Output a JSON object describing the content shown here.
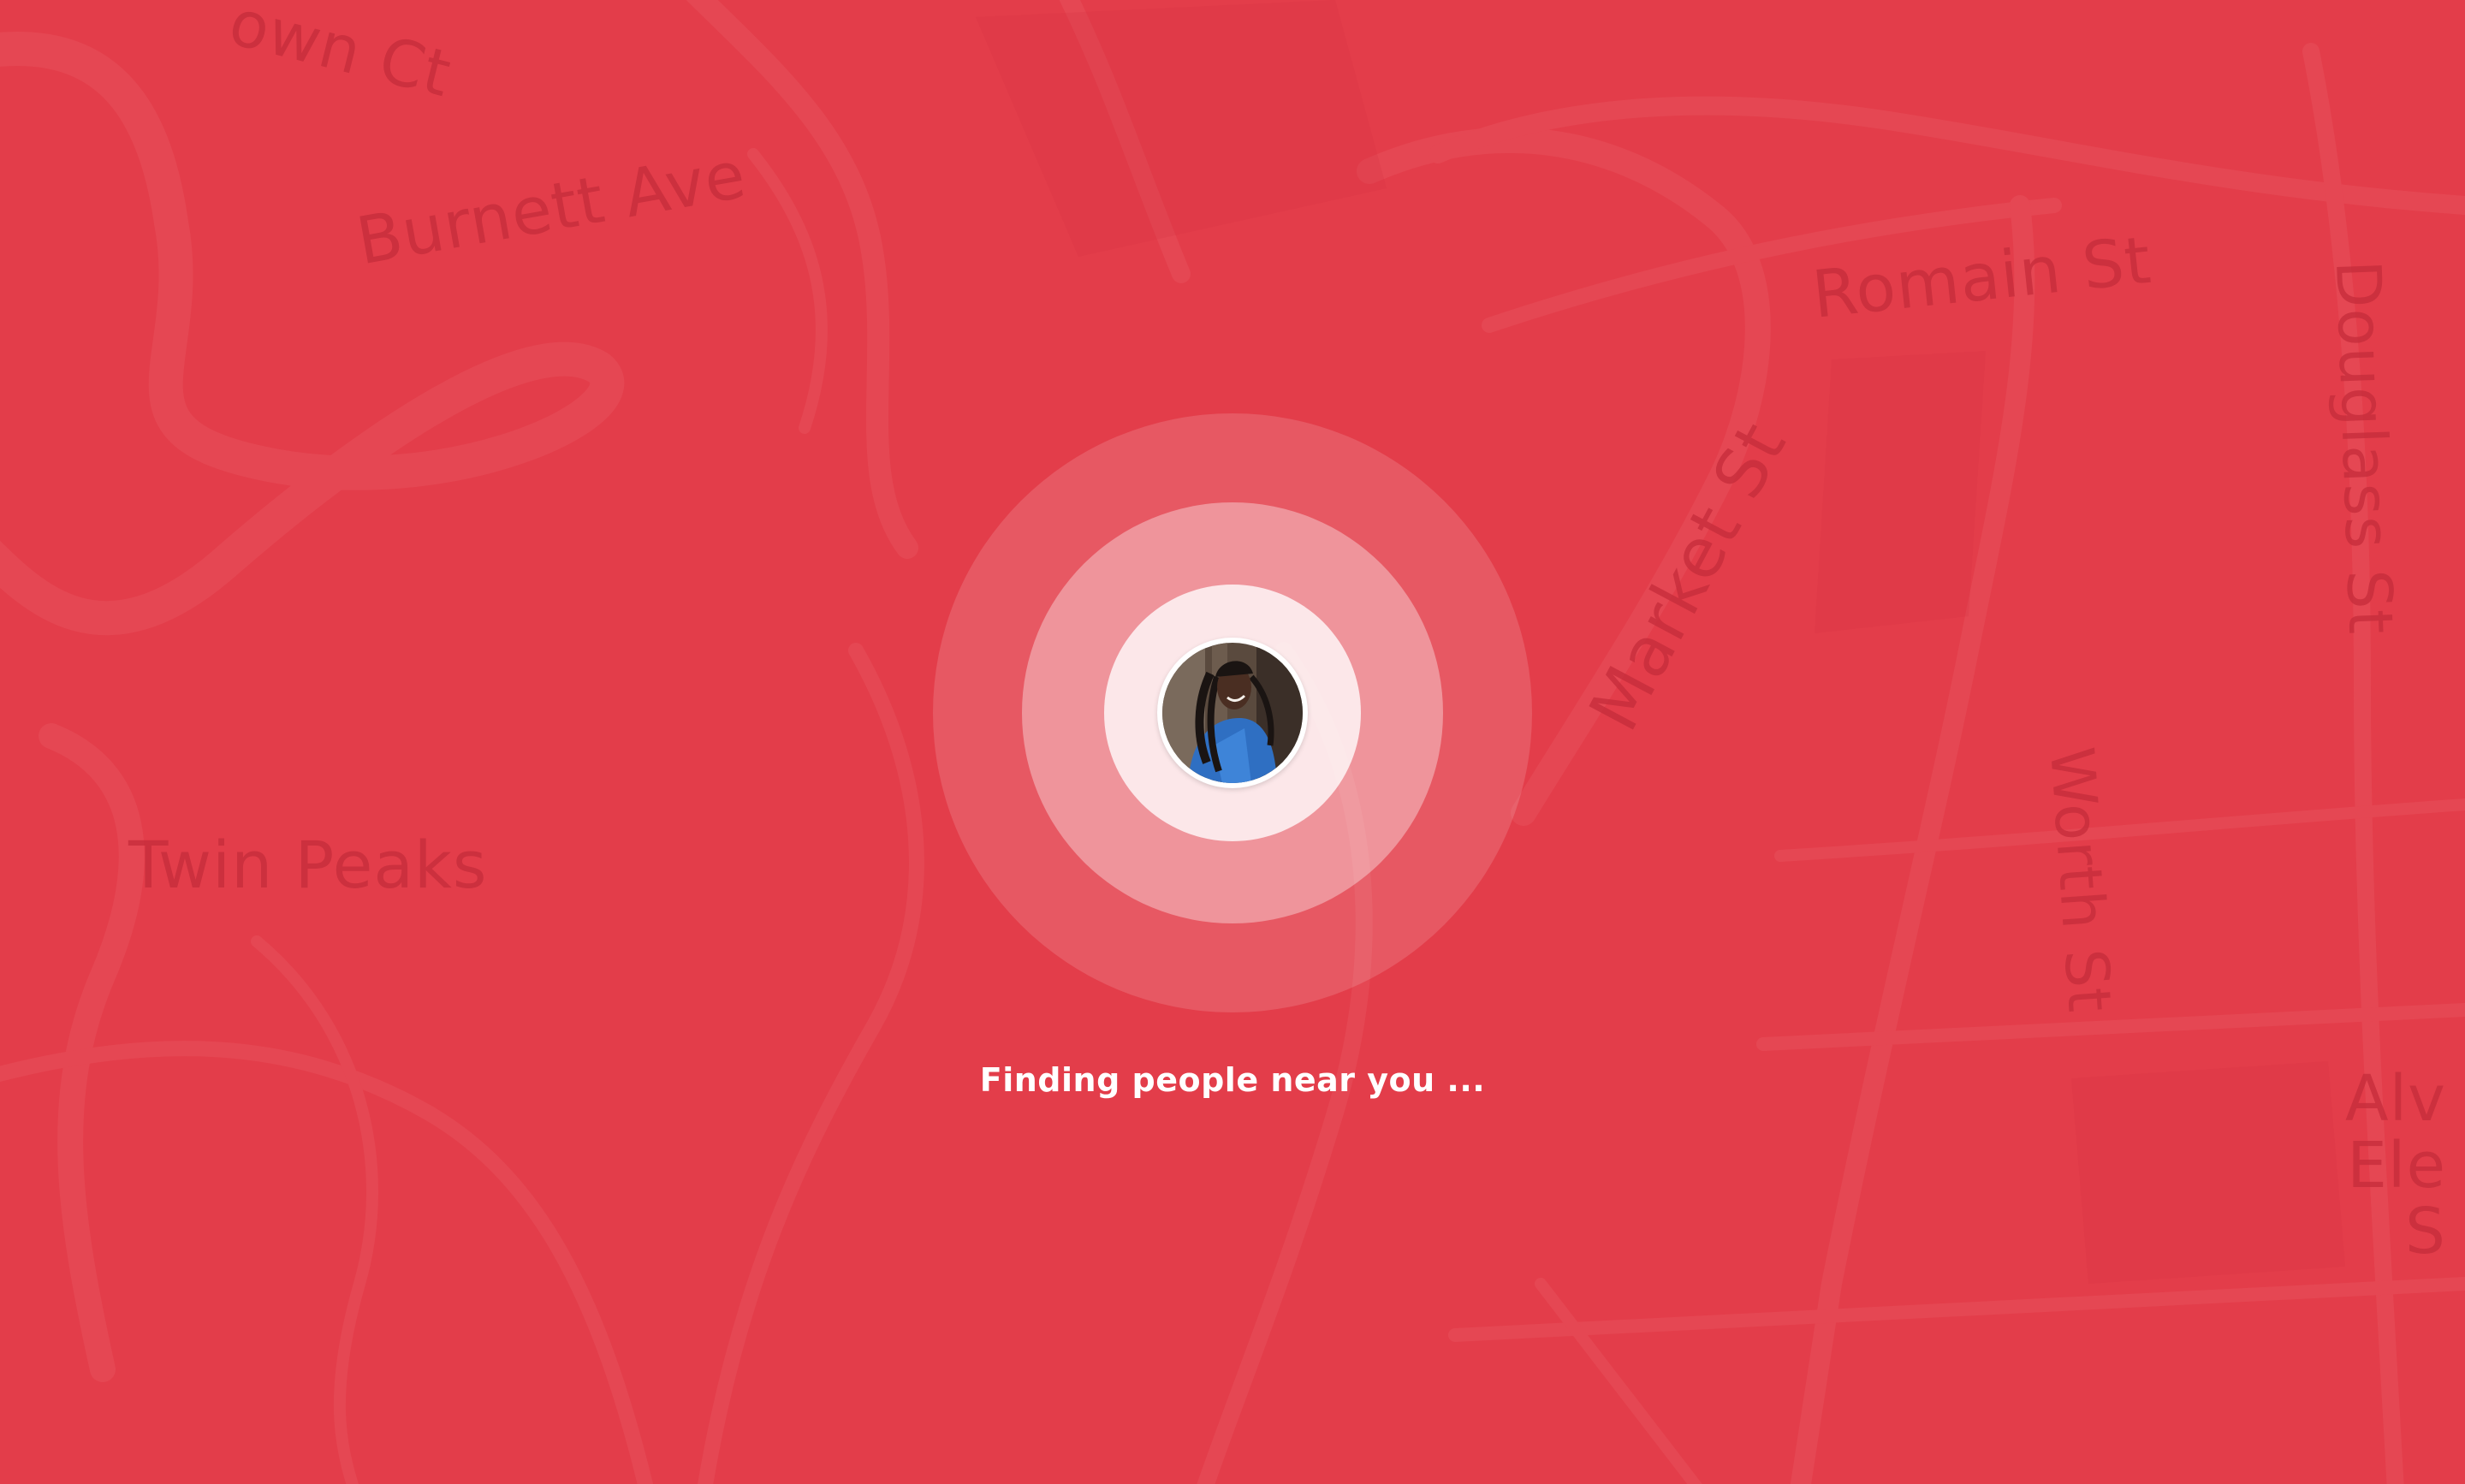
{
  "app": {
    "background_color": "#e33d4a",
    "accent_color": "#ffffff"
  },
  "map": {
    "street_labels": {
      "partial_court": "own Ct",
      "burnett": "Burnett Ave",
      "romain": "Romain St",
      "market": "Market St",
      "douglass": "Douglass St",
      "worth": "Worth St",
      "twin_peaks": "Twin Peaks",
      "alvarado": "Alv\nEle\nS"
    }
  },
  "search": {
    "status_text": "Finding people near you ...",
    "avatar_icon": "user-avatar-photo"
  }
}
